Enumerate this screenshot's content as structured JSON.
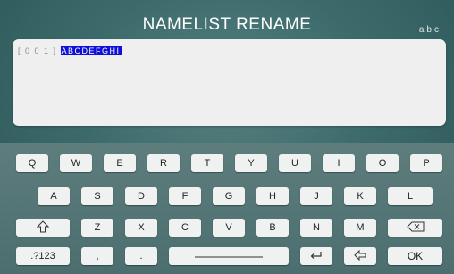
{
  "header": {
    "title": "NAMELIST  RENAME",
    "mode": "abc"
  },
  "editor": {
    "index": "[ 0 0 1 ]",
    "selected_text": "ABCDEFGHI"
  },
  "keyboard": {
    "row1": [
      "Q",
      "W",
      "E",
      "R",
      "T",
      "Y",
      "U",
      "I",
      "O",
      "P"
    ],
    "row2": [
      "A",
      "S",
      "D",
      "F",
      "G",
      "H",
      "J",
      "K",
      "L"
    ],
    "row3": [
      "Z",
      "X",
      "C",
      "V",
      "B",
      "N",
      "M"
    ],
    "symbols_label": ".?123",
    "comma": ",",
    "period": ".",
    "ok_label": "OK",
    "icons": {
      "shift": "shift-icon",
      "backspace": "backspace-icon",
      "space": "space-icon",
      "enter": "enter-icon",
      "undo": "undo-icon"
    }
  }
}
